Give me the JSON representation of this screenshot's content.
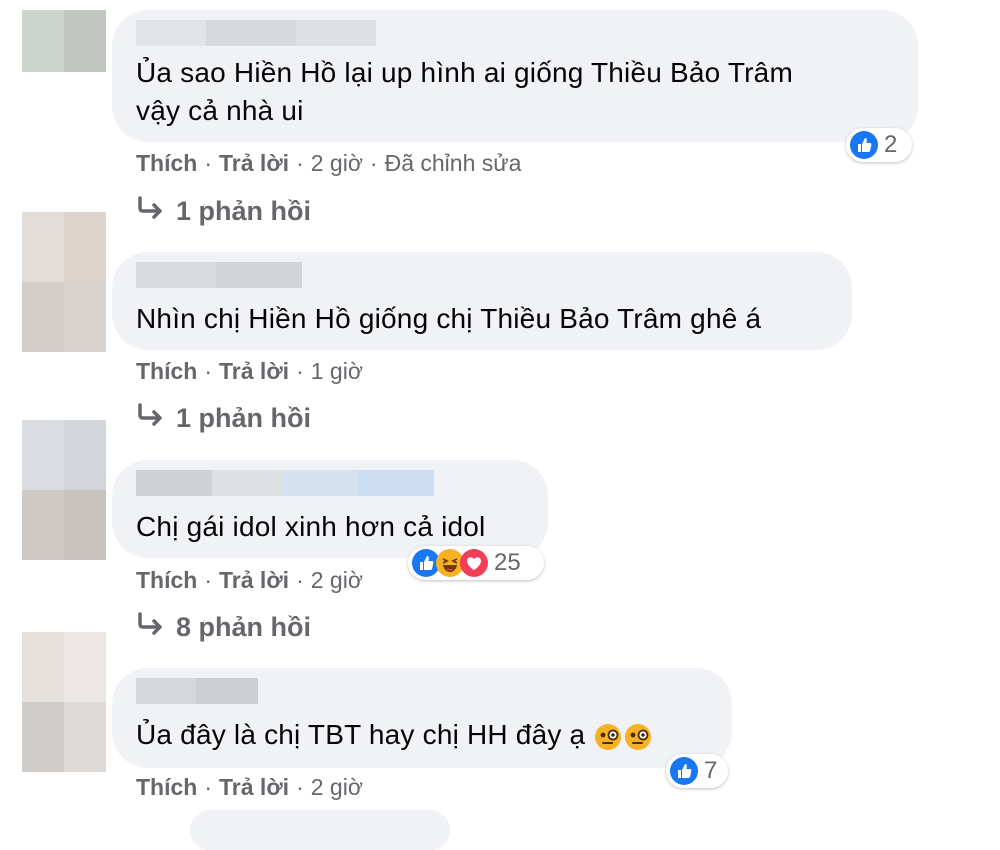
{
  "colors": {
    "bubble": "#f0f2f5",
    "meta_text": "#65676b",
    "comment_text": "#050505",
    "like_blue": "#1877f2",
    "haha_yellow": "#f7b125",
    "love_red": "#f33e58"
  },
  "comments": [
    {
      "text_lines": [
        "Ủa sao Hiền Hồ lại up hình ai giống Thiều Bảo Trâm",
        "vậy cả nhà ui"
      ],
      "actions": {
        "like": "Thích",
        "reply": "Trả lời",
        "time": "2 giờ",
        "edited": "Đã chỉnh sửa"
      },
      "reactions": {
        "icons": [
          "like-icon"
        ],
        "count": "2"
      },
      "replies_label": "1 phản hồi"
    },
    {
      "text_lines": [
        "Nhìn chị Hiền Hồ giống chị Thiều Bảo Trâm ghê á"
      ],
      "actions": {
        "like": "Thích",
        "reply": "Trả lời",
        "time": "1 giờ"
      },
      "replies_label": "1 phản hồi"
    },
    {
      "text_lines": [
        "Chị gái idol xinh hơn cả idol"
      ],
      "actions": {
        "like": "Thích",
        "reply": "Trả lời",
        "time": "2 giờ"
      },
      "reactions": {
        "icons": [
          "like-icon",
          "haha-icon",
          "love-icon"
        ],
        "count": "25"
      },
      "replies_label": "8 phản hồi"
    },
    {
      "text_lines": [
        "Ủa đây là chị TBT hay chị HH đây ạ"
      ],
      "emojis": [
        "monocle-face-emoji",
        "monocle-face-emoji"
      ],
      "actions": {
        "like": "Thích",
        "reply": "Trả lời",
        "time": "2 giờ"
      },
      "reactions": {
        "icons": [
          "like-icon"
        ],
        "count": "7"
      }
    }
  ]
}
